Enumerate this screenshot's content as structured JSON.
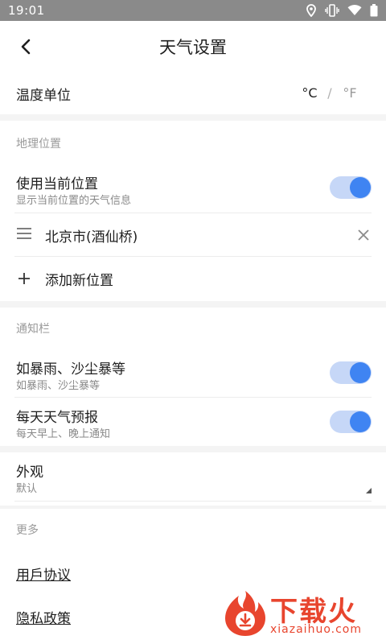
{
  "status_bar": {
    "time": "19:01",
    "icons": [
      "location-icon",
      "vibrate-icon",
      "wifi-icon",
      "battery-icon"
    ]
  },
  "app_bar": {
    "title": "天气设置",
    "back_icon": "chevron-left-icon"
  },
  "temperature_unit": {
    "label": "温度单位",
    "options": [
      "°C",
      "°F"
    ],
    "selected": "°C",
    "separator": "/"
  },
  "location_section": {
    "title": "地理位置",
    "use_current": {
      "label": "使用当前位置",
      "sub": "显示当前位置的天气信息",
      "enabled": true
    },
    "locations": [
      {
        "name": "北京市(酒仙桥)"
      }
    ],
    "add_label": "添加新位置"
  },
  "notification_section": {
    "title": "通知栏",
    "items": [
      {
        "label": "如暴雨、沙尘暴等",
        "sub": "如暴雨、沙尘暴等",
        "enabled": true
      },
      {
        "label": "每天天气预报",
        "sub": "每天早上、晚上通知",
        "enabled": true
      }
    ]
  },
  "appearance": {
    "label": "外观",
    "value": "默认"
  },
  "more_section": {
    "title": "更多",
    "links": [
      "用戶协议",
      "隐私政策"
    ]
  },
  "watermark": {
    "text": "下载火",
    "url": "xiazaihuo.com"
  },
  "colors": {
    "accent": "#3f84f2",
    "toggle_track": "#c6d7f7",
    "status_bar": "#8a8a8a",
    "watermark": "#e8452e"
  }
}
